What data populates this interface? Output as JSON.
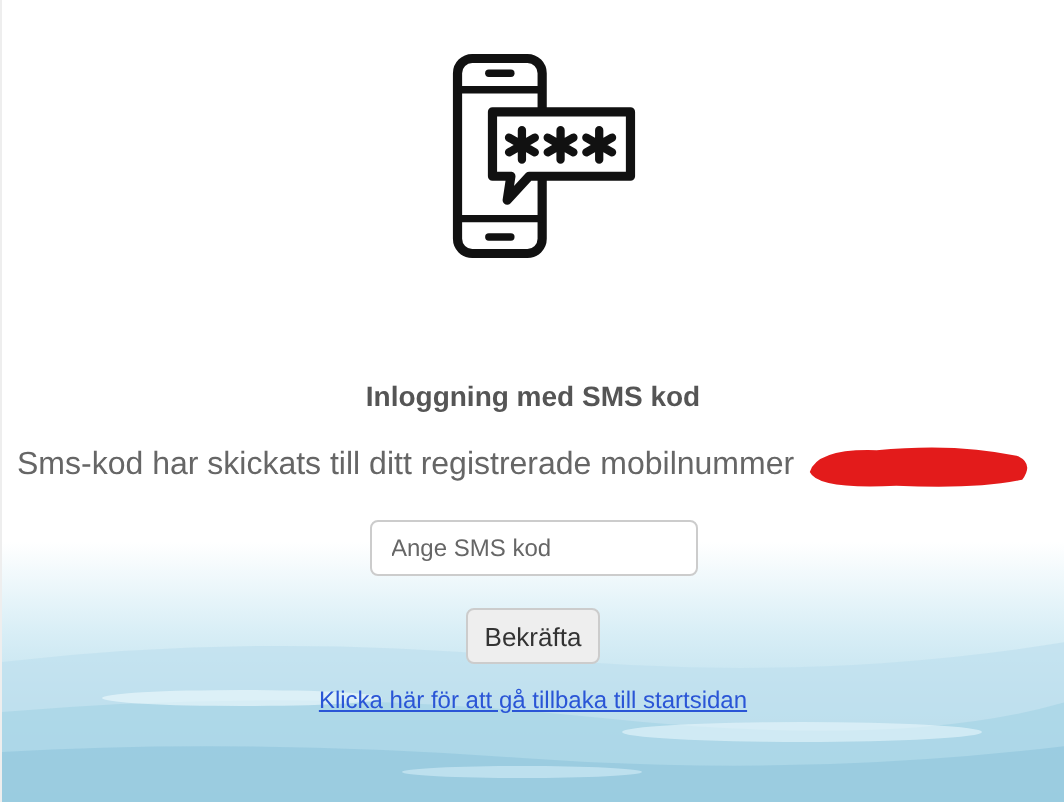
{
  "heading": "Inloggning med SMS kod",
  "message": "Sms-kod har skickats till ditt registrerade mobilnummer",
  "code_field": {
    "placeholder": "Ange SMS kod"
  },
  "confirm_button": "Bekräfta",
  "back_link": "Klicka här för att gå tillbaka till startsidan"
}
